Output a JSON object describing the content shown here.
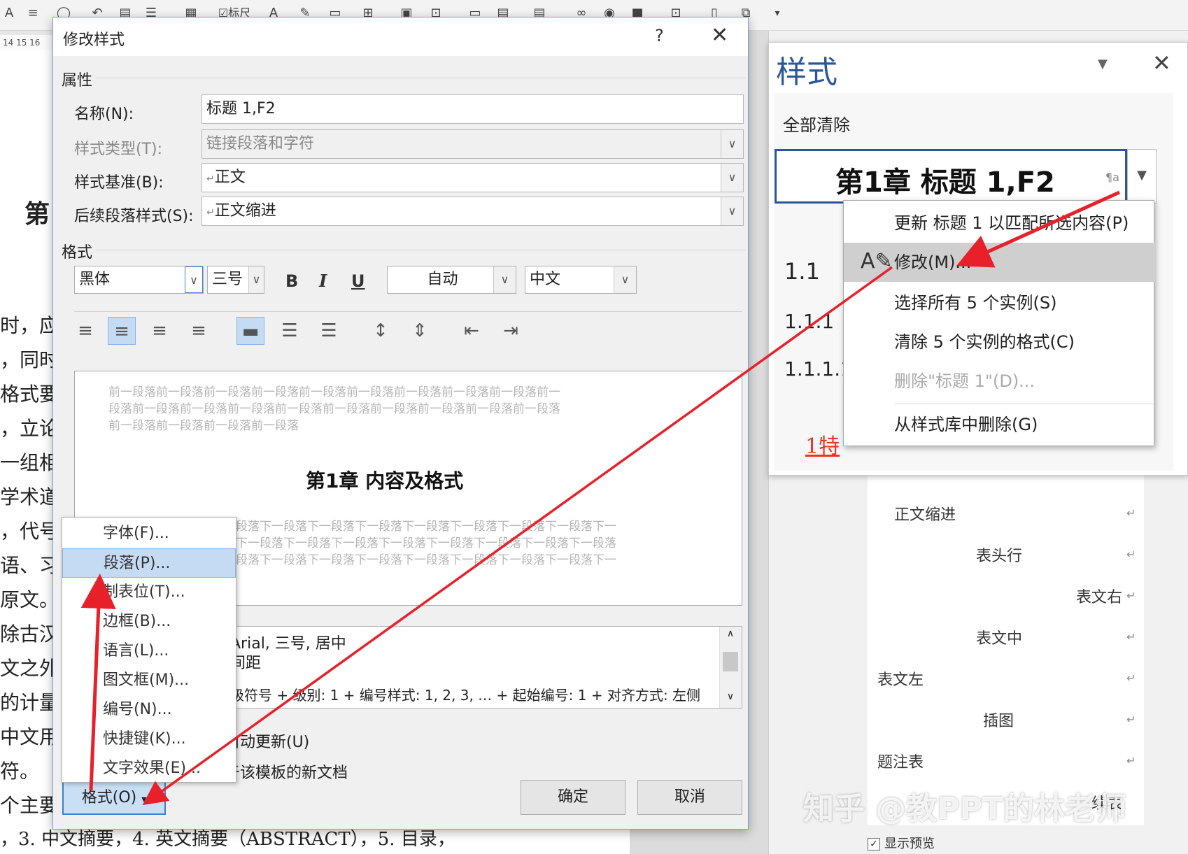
{
  "toolbar": {
    "a_glyph": "A",
    "label_biaochi": "标尺"
  },
  "ruler": {
    "text": "14 15 16"
  },
  "document": {
    "lines": [
      "第",
      "时，应",
      "，同时",
      "格式要求",
      "，立论",
      "一组相",
      "学术道",
      "，代号",
      "语、习",
      "原文。",
      "除古汉",
      "文之外",
      "的计量",
      "中文用",
      "符。",
      "个主要"
    ],
    "bottom_line": "，3. 中文摘要，4. 英文摘要（ABSTRACT），5. 目录，"
  },
  "dialog": {
    "title": "修改样式",
    "help": "?",
    "close": "✕",
    "properties_label": "属性",
    "name_label": "名称(N):",
    "name_value": "标题 1,F2",
    "type_label": "样式类型(T):",
    "type_value": "链接段落和字符",
    "based_label": "样式基准(B):",
    "based_value": "正文",
    "next_label": "后续段落样式(S):",
    "next_value": "正文缩进",
    "format_label": "格式",
    "font_value": "黑体",
    "size_value": "三号",
    "bold": "B",
    "italic": "I",
    "underline": "U",
    "color_value": "自动",
    "lang_value": "中文",
    "preview": {
      "prev_lines": [
        "前一段落前一段落前一段落前一段落前一段落前一段落前一段落前一段落前一段落前一",
        "段落前一段落前一段落前一段落前一段落前一段落前一段落前一段落前一段落前一段落",
        "前一段落前一段落前一段落前一段落"
      ],
      "heading": "第1章 内容及格式",
      "next_lines": [
        "段落下一段落下一段落下一段落下一段落下一段落下一段落下一段落下一",
        "下一段落下一段落下一段落下一段落下一段落下一段落下一段落下一段落",
        "段落下一段落下一段落下一段落下一段落下一段落下一段落下一段落下一"
      ]
    },
    "description": {
      "line1": "Arial, 三号, 居中",
      "line2": "间距",
      "line3": "级符号 + 级别: 1 + 编号样式: 1, 2, 3, … + 起始编号: 1 + 对齐方式: 左侧"
    },
    "auto_update": "自动更新(U)",
    "template_option": "于该模板的新文档",
    "format_button": "格式(O)",
    "ok": "确定",
    "cancel": "取消"
  },
  "format_menu": {
    "items": [
      "字体(F)...",
      "段落(P)...",
      "制表位(T)...",
      "边框(B)...",
      "语言(L)...",
      "图文框(M)...",
      "编号(N)...",
      "快捷键(K)...",
      "文字效果(E)..."
    ]
  },
  "styles_panel": {
    "title": "样式",
    "clear_all": "全部清除",
    "selected_style": "第1章  标题 1,F2",
    "headings": [
      "1.1",
      "1.1.1",
      "1.1.1.1"
    ],
    "red_item": "1特",
    "hidden_heading": "标题",
    "accent_color": "#2b579a"
  },
  "context_menu": {
    "items": [
      "更新 标题 1 以匹配所选内容(P)",
      "修改(M)...",
      "选择所有 5 个实例(S)",
      "清除 5 个实例的格式(C)",
      "删除\"标题 1\"(D)...",
      "从样式库中删除(G)"
    ]
  },
  "style_list": {
    "items": [
      "正文缩进",
      "表头行",
      "表文右",
      "表文中",
      "表文左",
      "插图",
      "题注表",
      "续表"
    ]
  },
  "show_preview": "显示预览",
  "watermark": "知乎 @教PPT的林老师",
  "arrow_color": "#e8202a"
}
